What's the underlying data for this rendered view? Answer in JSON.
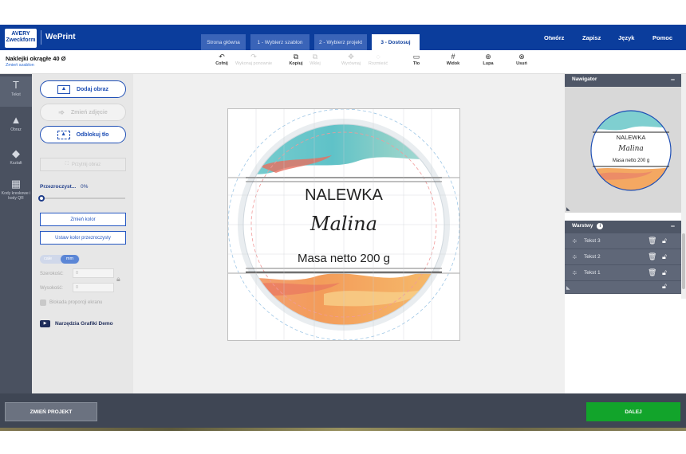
{
  "header": {
    "logo_line1": "AVERY",
    "logo_line2": "Zweckform",
    "brand": "WePrint",
    "tabs": [
      "Strona główna",
      "1 - Wybierz szablon",
      "2 - Wybierz projekt",
      "3 - Dostosuj"
    ],
    "menu": [
      "Otwórz",
      "Zapisz",
      "Język",
      "Pomoc"
    ],
    "brand_color": "#0b3d9c"
  },
  "project": {
    "title": "Naklejki okrągłe 40 Ø",
    "change_template": "Zmień szablon"
  },
  "toolbar": {
    "undo": "Cofnij",
    "redo": "Wykonaj ponownie",
    "copy": "Kopiuj",
    "paste": "Wklej",
    "align": "Wyrównaj",
    "distribute": "Rozmieść",
    "background": "Tło",
    "view": "Widok",
    "zoom": "Lupa",
    "delete": "Usuń"
  },
  "rail": [
    "Tekst",
    "Obraz",
    "Kształt",
    "Kody kreskowe i kody QR"
  ],
  "panel": {
    "add_image": "Dodaj obraz",
    "change_image": "Zmień zdjęcie",
    "remove_background": "Odblokuj tło",
    "crop_image": "Przytnij obraz",
    "transparency_label": "Przezroczyst...",
    "transparency_value": "0%",
    "change_color": "Zmień kolor",
    "set_transparent_color": "Ustaw kolor przezroczysty",
    "unit_inch": "cale",
    "unit_mm": "mm",
    "width_label": "Szerokość:",
    "width_value": "0",
    "height_label": "Wysokość:",
    "height_value": "0",
    "lock_ratio": "Blokada proporcji ekranu",
    "demo_link": "Narzędzia Grafiki Demo"
  },
  "label": {
    "line1": "NALEWKA",
    "line2": "Malina",
    "line3": "Masa netto 200 g"
  },
  "navigator": {
    "title": "Nawigator",
    "collapse": "−"
  },
  "layers": {
    "title": "Warstwy",
    "info": "i",
    "collapse": "−",
    "items": [
      "Tekst 3",
      "Tekst 2",
      "Tekst 1"
    ]
  },
  "footer": {
    "change_project": "ZMIEŃ PROJEKT",
    "next": "DALEJ",
    "next_color": "#12a42b"
  }
}
